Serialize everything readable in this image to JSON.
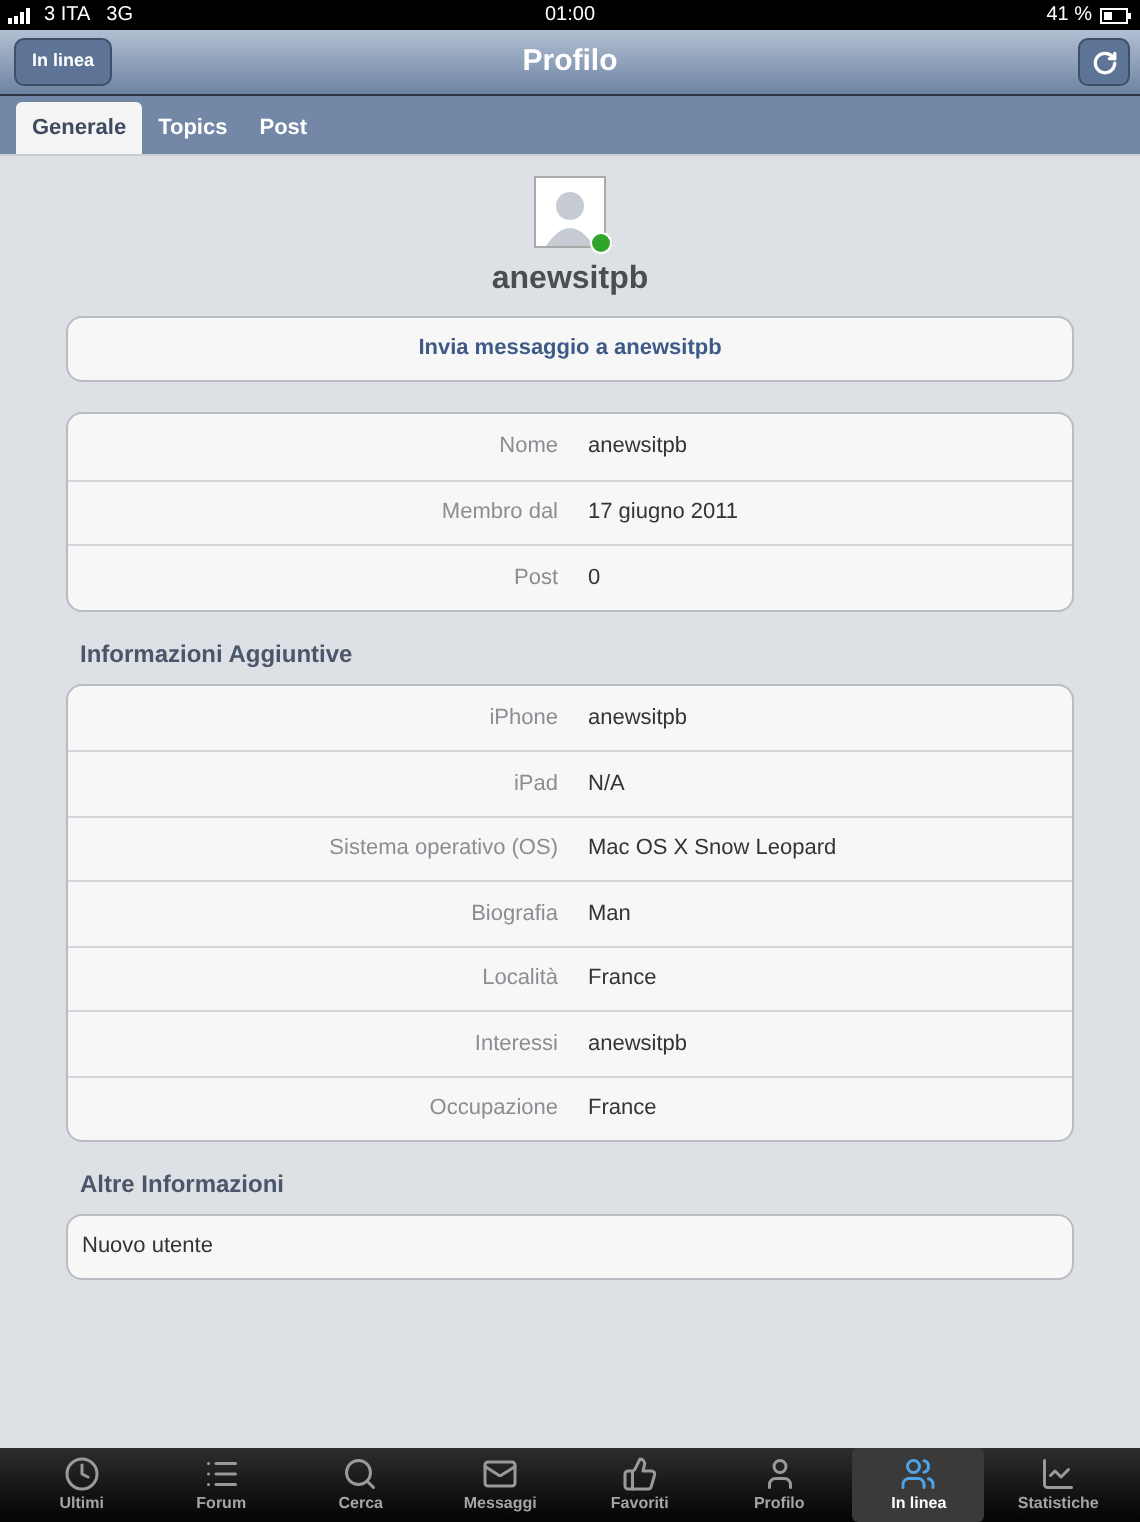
{
  "status_bar": {
    "carrier": "3 ITA",
    "network": "3G",
    "time": "01:00",
    "battery": "41 %"
  },
  "nav": {
    "back": "In linea",
    "title": "Profilo"
  },
  "tabs": [
    {
      "label": "Generale",
      "selected": true
    },
    {
      "label": "Topics",
      "selected": false
    },
    {
      "label": "Post",
      "selected": false
    }
  ],
  "profile": {
    "username": "anewsitpb",
    "online": true,
    "message_button": "Invia messaggio a anewsitpb"
  },
  "info": [
    {
      "label": "Nome",
      "value": "anewsitpb"
    },
    {
      "label": "Membro dal",
      "value": "17 giugno 2011"
    },
    {
      "label": "Post",
      "value": "0"
    }
  ],
  "additional": {
    "title": "Informazioni Aggiuntive",
    "rows": [
      {
        "label": "iPhone",
        "value": "anewsitpb"
      },
      {
        "label": "iPad",
        "value": "N/A"
      },
      {
        "label": "Sistema operativo (OS)",
        "value": "Mac OS X Snow Leopard"
      },
      {
        "label": "Biografia",
        "value": "Man"
      },
      {
        "label": "Località",
        "value": "France"
      },
      {
        "label": "Interessi",
        "value": "anewsitpb"
      },
      {
        "label": "Occupazione",
        "value": "France"
      }
    ]
  },
  "other": {
    "title": "Altre Informazioni",
    "text": "Nuovo utente"
  },
  "tab_bar": [
    {
      "label": "Ultimi",
      "selected": false
    },
    {
      "label": "Forum",
      "selected": false
    },
    {
      "label": "Cerca",
      "selected": false
    },
    {
      "label": "Messaggi",
      "selected": false
    },
    {
      "label": "Favoriti",
      "selected": false
    },
    {
      "label": "Profilo",
      "selected": false
    },
    {
      "label": "In linea",
      "selected": true
    },
    {
      "label": "Statistiche",
      "selected": false
    }
  ]
}
